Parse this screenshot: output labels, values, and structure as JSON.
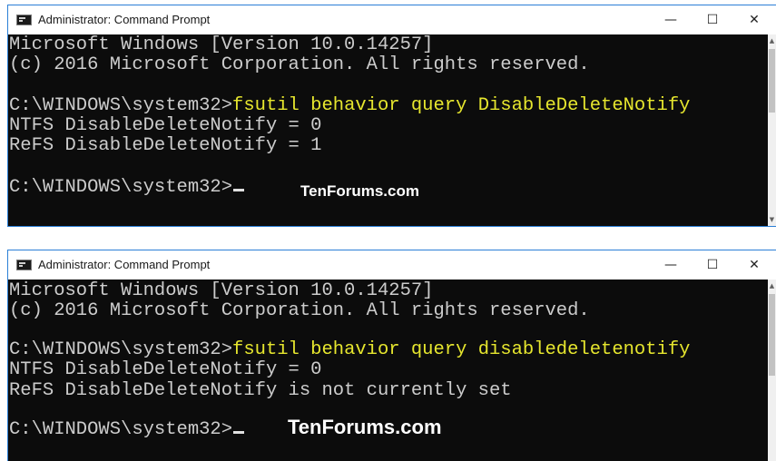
{
  "windows": [
    {
      "title": "Administrator: Command Prompt",
      "controls": {
        "minimize": "—",
        "maximize": "☐",
        "close": "✕"
      },
      "lines": {
        "l1": "Microsoft Windows [Version 10.0.14257]",
        "l2": "(c) 2016 Microsoft Corporation. All rights reserved.",
        "l3_prompt": "C:\\WINDOWS\\system32>",
        "l3_cmd": "fsutil behavior query DisableDeleteNotify",
        "l4": "NTFS DisableDeleteNotify = 0",
        "l5": "ReFS DisableDeleteNotify = 1",
        "l6_prompt": "C:\\WINDOWS\\system32>"
      },
      "watermark": "TenForums.com",
      "scrollbar": {
        "up": "▲",
        "down": "▼"
      }
    },
    {
      "title": "Administrator: Command Prompt",
      "controls": {
        "minimize": "—",
        "maximize": "☐",
        "close": "✕"
      },
      "lines": {
        "l1": "Microsoft Windows [Version 10.0.14257]",
        "l2": "(c) 2016 Microsoft Corporation. All rights reserved.",
        "l3_prompt": "C:\\WINDOWS\\system32>",
        "l3_cmd": "fsutil behavior query disabledeletenotify",
        "l4": "NTFS DisableDeleteNotify = 0",
        "l5": "ReFS DisableDeleteNotify is not currently set",
        "l6_prompt": "C:\\WINDOWS\\system32>"
      },
      "watermark": "TenForums.com",
      "scrollbar": {
        "up": "▲",
        "down": "▼"
      }
    }
  ],
  "colors": {
    "console_background": "#0c0c0c",
    "console_text": "#cccccc",
    "command_text": "#e6e62e",
    "titlebar": "#ffffff",
    "window_border": "#2b7fd6"
  },
  "icons": {
    "app": "command-prompt-icon",
    "minimize": "minimize-icon",
    "maximize": "maximize-icon",
    "close": "close-icon"
  }
}
